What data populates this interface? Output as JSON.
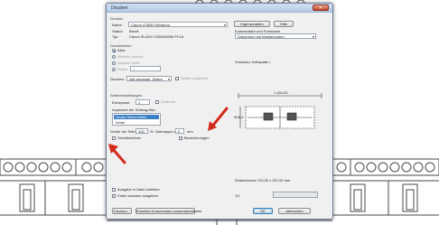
{
  "dialog": {
    "title": "Drucken",
    "close_glyph": "✕",
    "printer": {
      "section_label": "Drucker",
      "name_label": "Name:",
      "name_value": "Canon iC5540 Werbung",
      "status_label": "Status:",
      "status_value": "Bereit",
      "type_label": "Typ:",
      "type_value": "Canon iR-ADV C5540/5550 PCL6",
      "properties_button": "Eigenschaften",
      "help_button": "Hilfe",
      "comments_label": "Kommentare und Formulare",
      "comments_value": "Dokument und Markierungen"
    },
    "range": {
      "section_label": "Druckbereich",
      "all": "Alles",
      "current_view": "Aktuelle Ansicht",
      "current_page": "Aktuelle Seite",
      "pages_label": "Seiten",
      "pages_value": "1",
      "subset_label": "Drucken:",
      "subset_value": "Alle angegeb. Seiten",
      "reverse_label": "Seiten umkehren"
    },
    "page_handling": {
      "section_label": "Seiteneinstellungen",
      "copies_label": "Exemplare:",
      "copies_value": "1",
      "collate_label": "Sortieren",
      "scaling_label": "Anpassen der Seitengröße:",
      "scaling_options": [
        "Große Seiten teilen",
        "Keine"
      ],
      "tile_scale_label": "Größe der Teile:",
      "tile_scale_value": "100",
      "tile_scale_unit": "%",
      "overlap_label": "Überlappen:",
      "overlap_value": "0",
      "overlap_unit": "mm",
      "cut_marks_label": "Schnittzeichen",
      "labels_label": "Bezeichnungen"
    },
    "output": {
      "print_to_file": "Ausgabe in Datei umleiten",
      "print_color_as_black": "Farbe schwarz ausgeben"
    },
    "preview": {
      "heading": "Vorschau: Dreispalte r",
      "dim_horizontal": "1.454,53",
      "dim_vertical": "308,4",
      "zoom_text": "Seitenformat: 210,00 x 297,00 mm",
      "page_counter": "1/1"
    },
    "buttons": {
      "print_setup": "Drucken...",
      "advanced": "Erweitert",
      "summarize": "Kommentare zusammenfassen",
      "ok": "OK",
      "cancel": "Abbrechen"
    },
    "dropdown_glyph": "▾"
  },
  "colors": {
    "annotation_arrow": "#d42a1c",
    "selection": "#3d7fc4",
    "title_bar": "#b4cbe6"
  },
  "icons": [
    "close-icon",
    "dropdown-icon",
    "annotation-arrow-icon"
  ]
}
